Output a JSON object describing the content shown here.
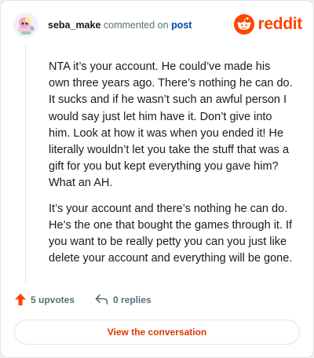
{
  "header": {
    "username": "seba_make",
    "action_text": "commented on",
    "post_link": "post",
    "brand": "reddit"
  },
  "comment": {
    "paragraphs": [
      "NTA it’s your account. He could’ve made his own three years ago. There’s nothing he can do. It sucks and if he wasn’t such an awful person I would say just let him have it. Don’t give into him. Look at how it was when you ended it! He literally wouldn’t let you take the stuff that was a gift for you but kept everything you gave him? What an AH.",
      "It’s your account and there’s nothing he can do. He’s the one that bought the games through it. If you want to be really petty you can you just like delete your account and everything will be gone."
    ]
  },
  "footer": {
    "upvotes": "5 upvotes",
    "replies": "0 replies",
    "view_button": "View the conversation"
  },
  "colors": {
    "brand": "#ff4500",
    "upvote": "#ff4500",
    "link": "#0045ac",
    "button_text": "#d93a00"
  },
  "icons": [
    "avatar",
    "reddit-snoo-icon",
    "upvote-arrow-icon",
    "reply-arrow-icon"
  ]
}
